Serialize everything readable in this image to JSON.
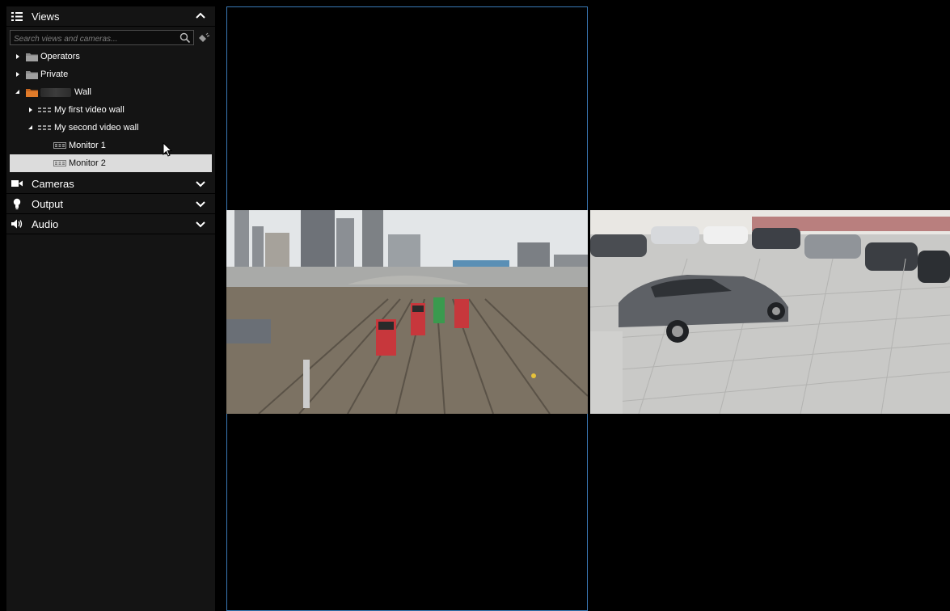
{
  "views_section": {
    "title": "Views",
    "search_placeholder": "Search views and cameras..."
  },
  "tree": {
    "operators": "Operators",
    "private": "Private",
    "wall": "Wall",
    "first_wall": "My first video wall",
    "second_wall": "My second video wall",
    "monitor1": "Monitor 1",
    "monitor2": "Monitor 2"
  },
  "sections": {
    "cameras": "Cameras",
    "output": "Output",
    "audio": "Audio"
  },
  "colors": {
    "accent_border": "#3a79b6",
    "folder_gray": "#8a8a8a",
    "folder_orange": "#e07b2a",
    "selected_row": "#dcdcdc"
  },
  "icons": [
    "grid-icon",
    "search-icon",
    "clear-search-icon",
    "camera-icon",
    "bulb-icon",
    "speaker-icon",
    "folder-icon",
    "video-wall-icon",
    "monitor-icon",
    "expand-triangle-icon",
    "chevron-up-icon",
    "chevron-down-icon",
    "mouse-cursor-icon"
  ]
}
